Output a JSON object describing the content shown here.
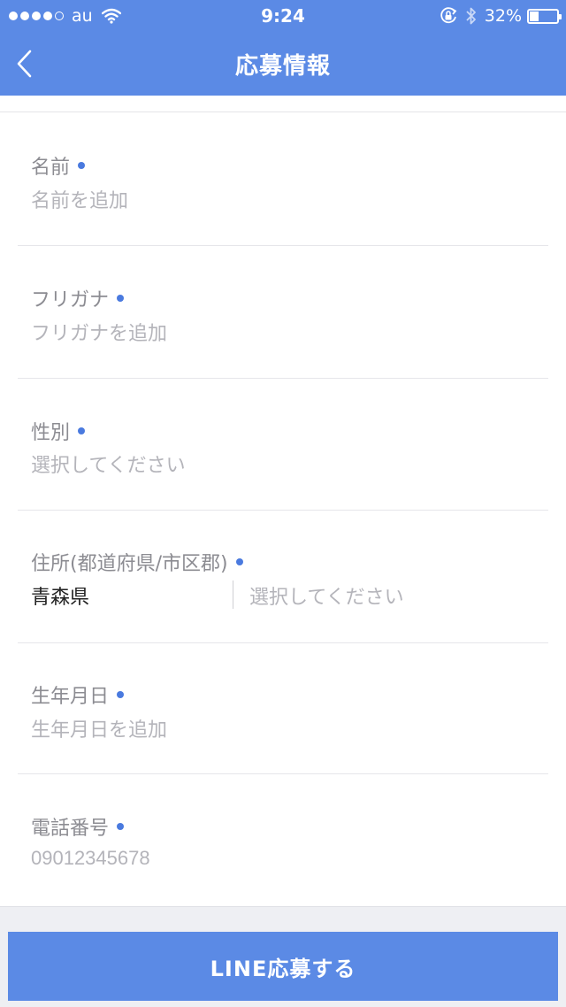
{
  "status_bar": {
    "carrier": "au",
    "time": "9:24",
    "battery_percent": "32%",
    "battery_level": 0.32,
    "icons": [
      "signal-dots-icon",
      "wifi-icon",
      "rotation-lock-icon",
      "bluetooth-icon",
      "battery-icon"
    ]
  },
  "header": {
    "title": "応募情報",
    "back_icon": "chevron-left-icon",
    "color": "#5b8ae5"
  },
  "form": {
    "required_dot_color": "#4a7adf",
    "name": {
      "label": "名前",
      "placeholder": "名前を追加"
    },
    "furigana": {
      "label": "フリガナ",
      "placeholder": "フリガナを追加"
    },
    "gender": {
      "label": "性別",
      "placeholder": "選択してください"
    },
    "address": {
      "label": "住所(都道府県/市区郡)",
      "prefecture_value": "青森県",
      "city_placeholder": "選択してください"
    },
    "birthday": {
      "label": "生年月日",
      "placeholder": "生年月日を追加"
    },
    "phone": {
      "label": "電話番号",
      "placeholder": "09012345678"
    }
  },
  "footer": {
    "submit_label": "LINE応募する"
  }
}
